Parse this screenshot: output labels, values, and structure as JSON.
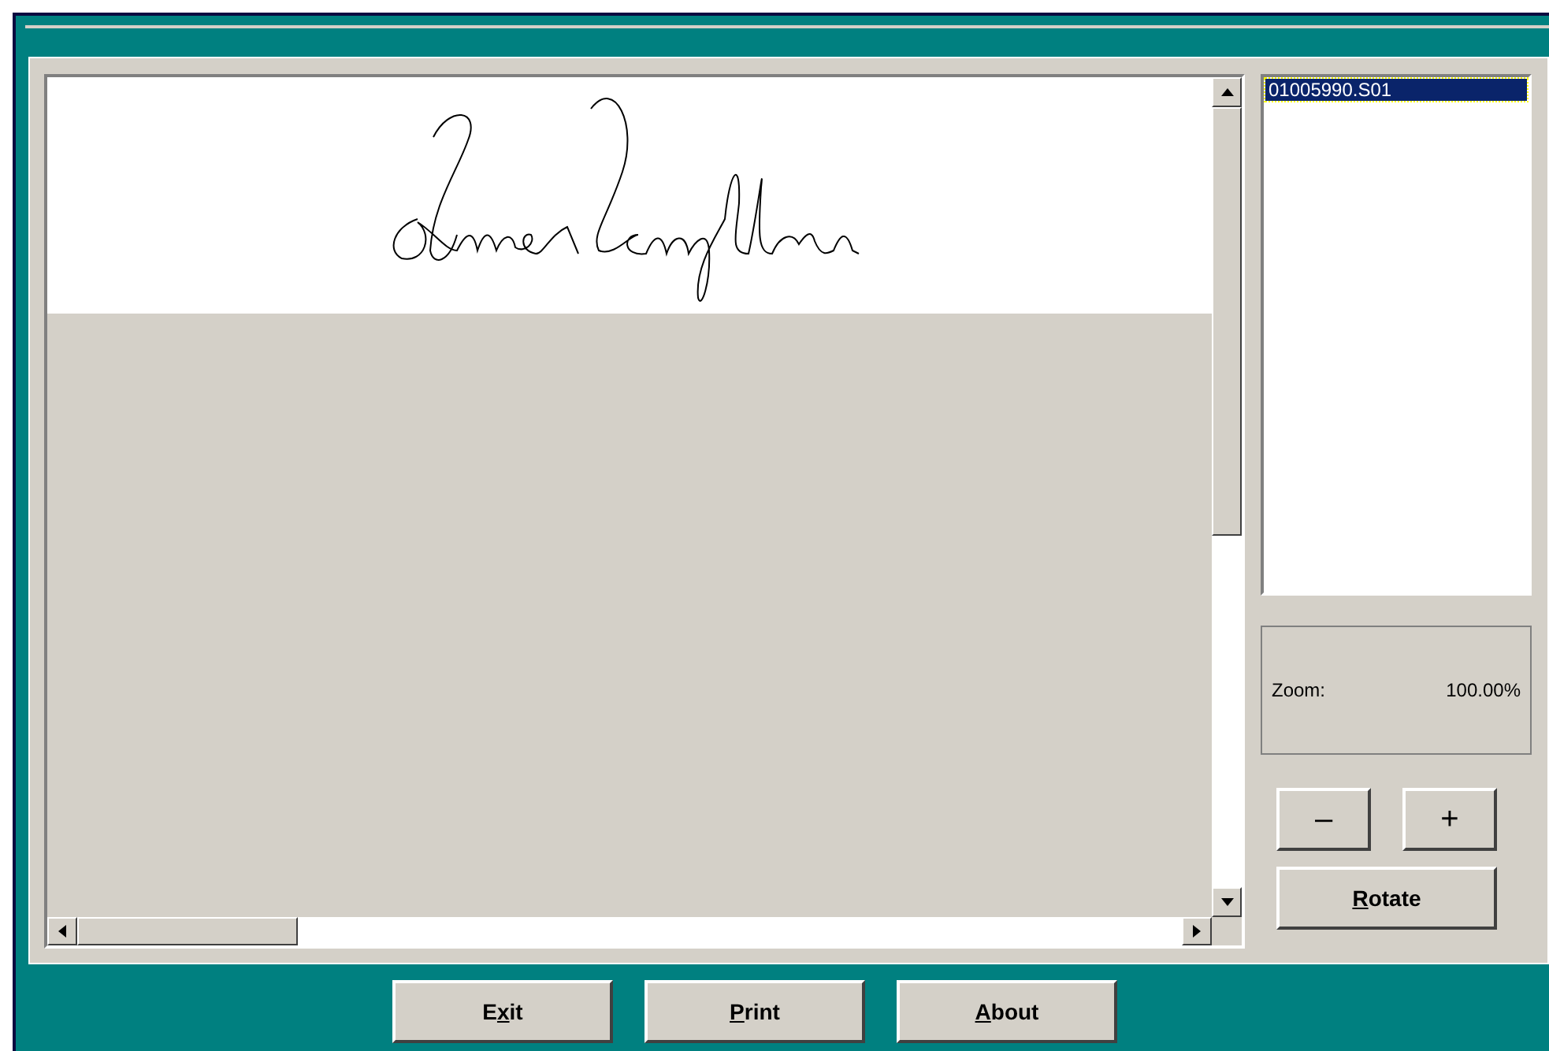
{
  "file_list": {
    "items": [
      {
        "label": "01005990.S01",
        "selected": true
      }
    ]
  },
  "zoom": {
    "label": "Zoom:",
    "value": "100.00%"
  },
  "zoom_buttons": [
    "–",
    "+"
  ],
  "rotate_button": {
    "key": "R",
    "after": "otate"
  },
  "buttons": [
    {
      "before": "E",
      "key": "x",
      "after": "it"
    },
    {
      "key": "P",
      "after": "rint"
    },
    {
      "key": "A",
      "after": "bout"
    }
  ]
}
